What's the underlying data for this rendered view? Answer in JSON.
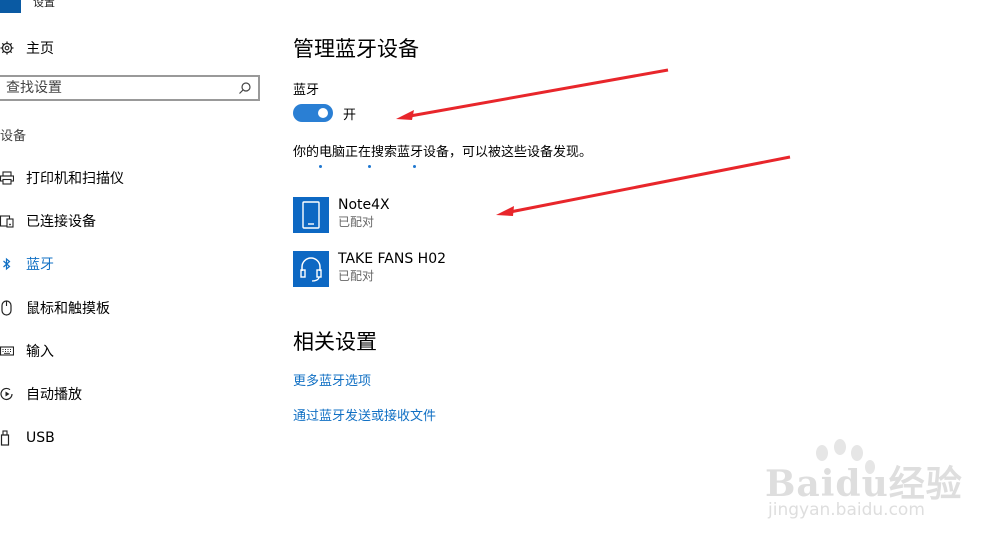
{
  "app": {
    "title": "设置"
  },
  "sidebar": {
    "home_label": "主页",
    "search_placeholder": "查找设置",
    "section_label": "设备",
    "items": [
      {
        "label": "打印机和扫描仪",
        "icon": "printer-icon"
      },
      {
        "label": "已连接设备",
        "icon": "connected-devices-icon"
      },
      {
        "label": "蓝牙",
        "icon": "bluetooth-icon",
        "active": true
      },
      {
        "label": "鼠标和触摸板",
        "icon": "mouse-icon"
      },
      {
        "label": "输入",
        "icon": "keyboard-icon"
      },
      {
        "label": "自动播放",
        "icon": "autoplay-icon"
      },
      {
        "label": "USB",
        "icon": "usb-icon"
      }
    ]
  },
  "main": {
    "title": "管理蓝牙设备",
    "bluetooth_label": "蓝牙",
    "toggle_state": "开",
    "description": "你的电脑正在搜索蓝牙设备，可以被这些设备发现。",
    "devices": [
      {
        "name": "Note4X",
        "status": "已配对",
        "icon": "phone-icon"
      },
      {
        "name": "TAKE FANS H02",
        "status": "已配对",
        "icon": "headset-icon"
      }
    ],
    "related_title": "相关设置",
    "links": [
      "更多蓝牙选项",
      "通过蓝牙发送或接收文件"
    ]
  },
  "watermark": {
    "brand": "Baidu经验",
    "url": "jingyan.baidu.com"
  },
  "colors": {
    "accent": "#1170c4",
    "tile": "#0d68c3",
    "toggle_on": "#2a7fd4",
    "arrow": "#e8262b"
  }
}
